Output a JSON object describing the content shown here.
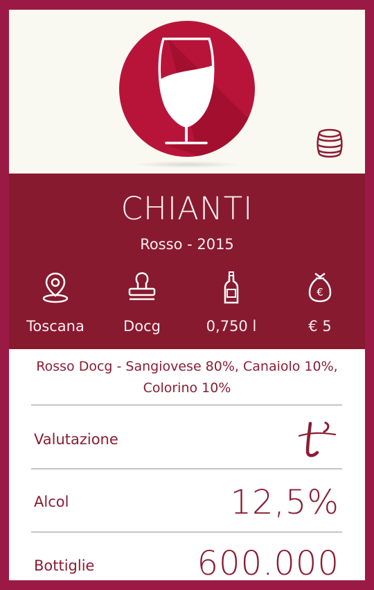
{
  "wine": {
    "name": "CHIANTI",
    "subtitle": "Rosso - 2015",
    "description": "Rosso Docg - Sangiovese 80%, Canaiolo 10%, Colorino 10%"
  },
  "specs": [
    {
      "icon": "location-pin-icon",
      "value": "Toscana"
    },
    {
      "icon": "stamp-icon",
      "value": "Docg"
    },
    {
      "icon": "bottle-icon",
      "value": "0,750 l"
    },
    {
      "icon": "money-bag-icon",
      "value": "€ 5"
    }
  ],
  "details": {
    "rating": {
      "label": "Valutazione",
      "icon": "rating-logo-icon"
    },
    "alcohol": {
      "label": "Alcol",
      "value": "12,5%"
    },
    "bottles": {
      "label": "Bottiglie",
      "value": "600.000"
    }
  },
  "colors": {
    "frame": "#9b1a45",
    "circle": "#b8143a",
    "band": "#871a2f",
    "text_accent": "#8a1c33",
    "hero_bg": "#faf9f1"
  }
}
